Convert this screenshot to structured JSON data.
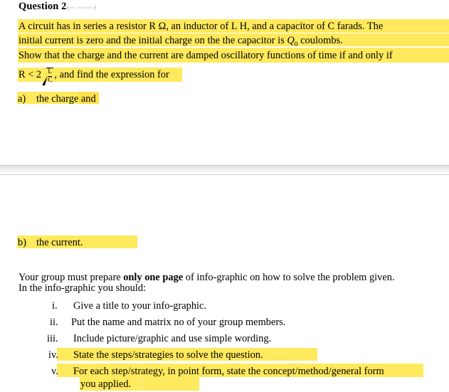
{
  "document": {
    "heading": {
      "title": "Question 2",
      "marks_note": "(..   ......)"
    },
    "paragraphs": {
      "problem_line1": "A circuit has in series a resistor R Ω, an inductor of L H, and a capacitor of C farads. The",
      "problem_line2_a": "initial current is zero and the initial charge on the the capacitor is ",
      "problem_line2_q": "Q",
      "problem_line2_sub": "0",
      "problem_line2_b": " coulombs.",
      "show_line": "Show that the charge and the current are damped oscillatory functions of time if and only if"
    },
    "formula": {
      "prefix": "R < 2",
      "numerator": "L",
      "denominator": "C",
      "suffix": ", and find the expression for"
    },
    "parts": [
      {
        "label": "a)",
        "text": "the charge and"
      },
      {
        "label": "b)",
        "text": "the current."
      }
    ],
    "instructions": {
      "line1_pre": "Your group must prepare ",
      "line1_bold": "only one page",
      "line1_post": " of info-graphic on how to solve the problem given.",
      "line2": "In the info-graphic you should:"
    },
    "checklist": [
      {
        "numeral": "i.",
        "text": "Give a title to your info-graphic."
      },
      {
        "numeral": "ii.",
        "text": "Put the name and matrix no of your group members."
      },
      {
        "numeral": "iii.",
        "text": "Include picture/graphic and use simple wording."
      },
      {
        "numeral": "iv.",
        "text": "State the steps/strategies to solve the question."
      },
      {
        "numeral": "v.",
        "text": "For each step/strategy, in point form, state the concept/method/general form"
      }
    ],
    "checklist_v_continuation": "you applied.",
    "colors": {
      "highlight": "#ffe95c",
      "highlight_soft": "#ffeb6b",
      "highlight_deep": "#ffe04a",
      "text": "#000000",
      "page_background": "#ffffff",
      "separator": "#e0e0e0"
    }
  }
}
